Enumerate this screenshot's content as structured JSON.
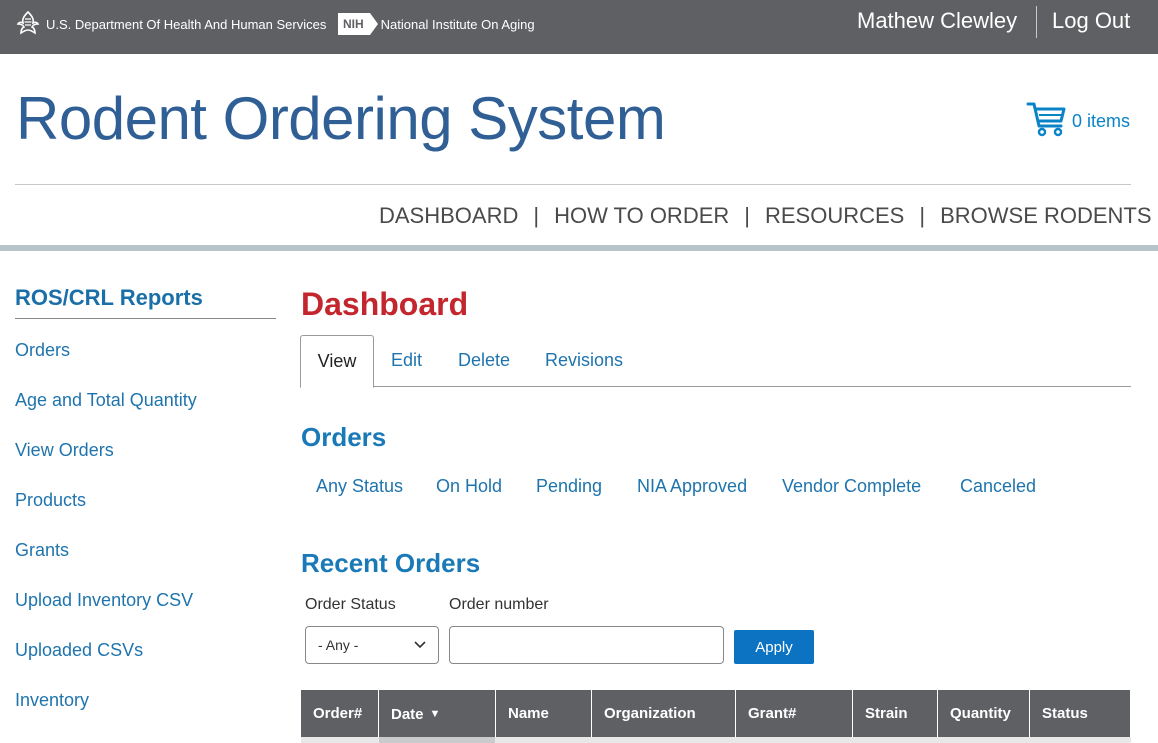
{
  "gov_bar": {
    "hhs_label": "U.S. Department Of Health And Human Services",
    "nih_logo": "NIH",
    "nih_label": "National Institute On Aging",
    "user_name": "Mathew Clewley",
    "logout_label": "Log Out"
  },
  "header": {
    "site_title": "Rodent Ordering System",
    "cart_label": "0 items"
  },
  "main_nav": {
    "items": [
      {
        "label": "DASHBOARD"
      },
      {
        "label": "HOW TO ORDER"
      },
      {
        "label": "RESOURCES"
      },
      {
        "label": "BROWSE RODENTS"
      }
    ],
    "separator": "|",
    "dropdown_caret": "▼"
  },
  "sidebar": {
    "title": "ROS/CRL Reports",
    "items": [
      {
        "label": "Orders"
      },
      {
        "label": "Age and Total Quantity"
      },
      {
        "label": "View Orders"
      },
      {
        "label": "Products"
      },
      {
        "label": "Grants"
      },
      {
        "label": "Upload Inventory CSV"
      },
      {
        "label": "Uploaded CSVs"
      },
      {
        "label": "Inventory"
      }
    ]
  },
  "main": {
    "page_title": "Dashboard",
    "tabs": [
      {
        "label": "View"
      },
      {
        "label": "Edit"
      },
      {
        "label": "Delete"
      },
      {
        "label": "Revisions"
      }
    ],
    "orders_title": "Orders",
    "status_filters": [
      {
        "label": "Any Status"
      },
      {
        "label": "On Hold"
      },
      {
        "label": "Pending"
      },
      {
        "label": "NIA Approved"
      },
      {
        "label": "Vendor Complete"
      },
      {
        "label": "Canceled"
      }
    ],
    "recent_orders_title": "Recent Orders",
    "filters": {
      "order_status_label": "Order Status",
      "order_status_value": "- Any -",
      "order_number_label": "Order number",
      "order_number_value": "",
      "apply_label": "Apply"
    },
    "table": {
      "columns": [
        "Order#",
        "Date",
        "Name",
        "Organization",
        "Grant#",
        "Strain",
        "Quantity",
        "Status"
      ],
      "sort_indicator": "▼"
    }
  },
  "colors": {
    "gov_bar": "#5f6063",
    "site_title": "#2f5f95",
    "link": "#1f74ad",
    "page_title": "#c4262e",
    "section_title": "#1a7ab8",
    "apply_button": "#0b73c2"
  }
}
